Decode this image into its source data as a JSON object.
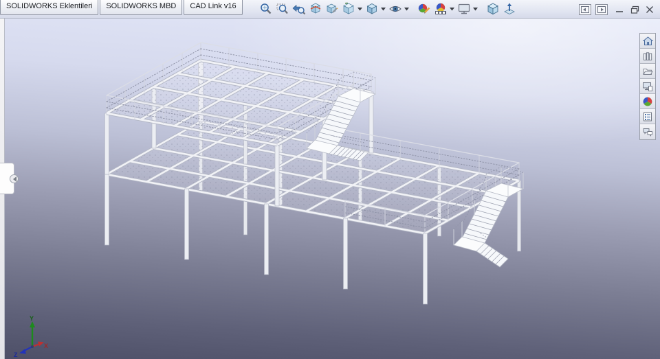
{
  "app": {
    "name": "SOLIDWORKS",
    "window_kind": "CAD 3D viewport"
  },
  "tab_bar": {
    "tabs": [
      {
        "label": "SOLIDWORKS Eklentileri"
      },
      {
        "label": "SOLIDWORKS MBD"
      },
      {
        "label": "CAD Link v16"
      }
    ]
  },
  "toolbar": {
    "buttons": [
      {
        "name": "zoom-to-fit",
        "has_dropdown": false
      },
      {
        "name": "zoom-to-area",
        "has_dropdown": false
      },
      {
        "name": "previous-view",
        "has_dropdown": false
      },
      {
        "name": "section-view",
        "has_dropdown": false
      },
      {
        "name": "3d-drawing-view",
        "has_dropdown": false
      },
      {
        "name": "view-orientation",
        "has_dropdown": true
      },
      {
        "name": "display-style",
        "has_dropdown": true
      },
      {
        "name": "hide-show-items",
        "has_dropdown": true
      },
      {
        "name": "edit-appearance",
        "has_dropdown": false
      },
      {
        "name": "apply-scene",
        "has_dropdown": true
      },
      {
        "name": "view-settings",
        "has_dropdown": true
      },
      {
        "name": "isometric-view",
        "has_dropdown": false
      },
      {
        "name": "normal-to",
        "has_dropdown": false
      }
    ]
  },
  "window_controls": [
    {
      "name": "toggle-left-pane"
    },
    {
      "name": "toggle-right-pane"
    },
    {
      "name": "minimize"
    },
    {
      "name": "restore"
    },
    {
      "name": "close"
    }
  ],
  "task_pane": {
    "items": [
      {
        "name": "solidworks-resources"
      },
      {
        "name": "design-library"
      },
      {
        "name": "file-explorer"
      },
      {
        "name": "view-palette"
      },
      {
        "name": "appearances-scenes"
      },
      {
        "name": "custom-properties"
      },
      {
        "name": "solidworks-forum"
      }
    ]
  },
  "left_panel": {
    "name": "featuremanager-collapsed-flyout"
  },
  "viewport": {
    "model": "two-level structural steel platform with grating decks, perimeter handrails and two switchback staircases",
    "triad": {
      "x": "X",
      "y": "Y",
      "z": "Z"
    },
    "colors": {
      "bg_top": "#e3e7f8",
      "bg_bottom": "#4d4f67",
      "structure": "#f1f2f6",
      "structure_edge": "#b8bcc9",
      "triad_x": "#c03030",
      "triad_y": "#1d8a1d",
      "triad_z": "#2233bb"
    }
  }
}
